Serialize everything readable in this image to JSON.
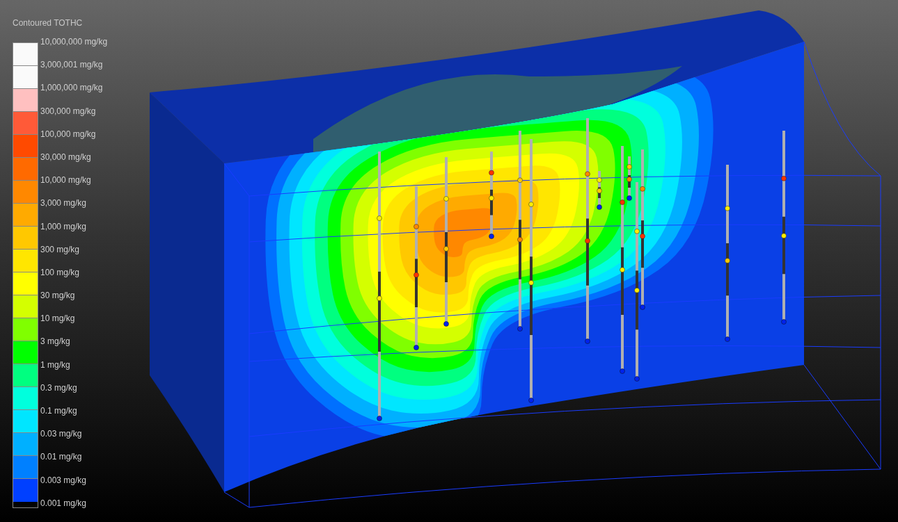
{
  "legend": {
    "title": "Contoured TOTHC",
    "labels": [
      "10,000,000 mg/kg",
      "3,000,001 mg/kg",
      "1,000,000 mg/kg",
      "300,000 mg/kg",
      "100,000 mg/kg",
      "30,000 mg/kg",
      "10,000 mg/kg",
      "3,000 mg/kg",
      "1,000 mg/kg",
      "300 mg/kg",
      "100 mg/kg",
      "30 mg/kg",
      "10 mg/kg",
      "3 mg/kg",
      "1 mg/kg",
      "0.3 mg/kg",
      "0.1 mg/kg",
      "0.03 mg/kg",
      "0.01 mg/kg",
      "0.003 mg/kg",
      "0.001 mg/kg"
    ],
    "bands": [
      {
        "color": "#fafafa"
      },
      {
        "color": "#fafafa"
      },
      {
        "color": "#ffc0c0"
      },
      {
        "color": "#ff5a38"
      },
      {
        "color": "#ff4a00"
      },
      {
        "color": "#ff6a00"
      },
      {
        "color": "#ff8800"
      },
      {
        "color": "#ffaa00"
      },
      {
        "color": "#ffc800"
      },
      {
        "color": "#ffe600"
      },
      {
        "color": "#ffff00"
      },
      {
        "color": "#d4ff00"
      },
      {
        "color": "#80ff00"
      },
      {
        "color": "#00ff00"
      },
      {
        "color": "#00ff80"
      },
      {
        "color": "#00ffdd"
      },
      {
        "color": "#00e6ff"
      },
      {
        "color": "#00b0ff"
      },
      {
        "color": "#0080ff"
      },
      {
        "color": "#0040ff"
      }
    ]
  }
}
